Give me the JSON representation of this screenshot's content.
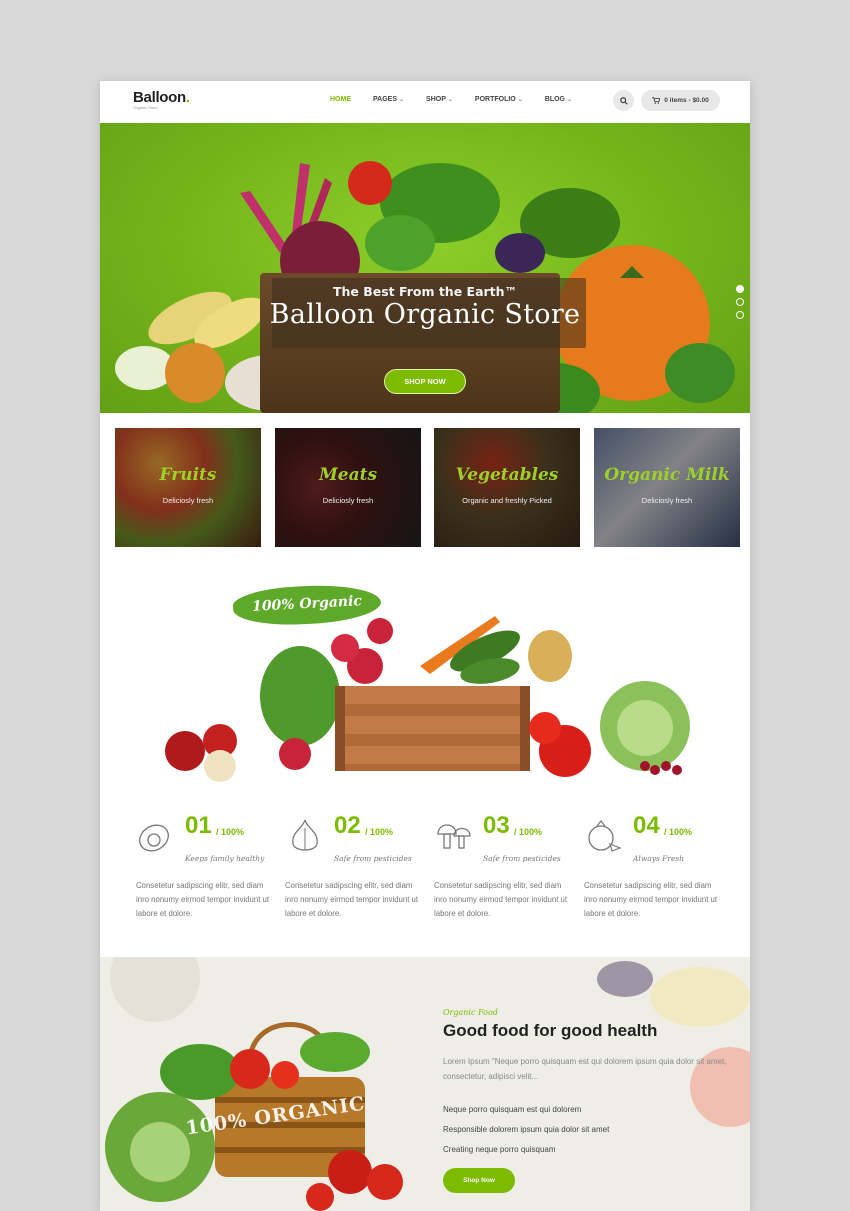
{
  "brand": {
    "name": "Balloon",
    "dot": ".",
    "subtitle": "Organic Store",
    "accent_color": "#7cbb00"
  },
  "nav": {
    "items": [
      {
        "label": "HOME",
        "active": true,
        "dropdown": false
      },
      {
        "label": "PAGES",
        "active": false,
        "dropdown": true
      },
      {
        "label": "SHOP",
        "active": false,
        "dropdown": true
      },
      {
        "label": "PORTFOLIO",
        "active": false,
        "dropdown": true
      },
      {
        "label": "BLOG",
        "active": false,
        "dropdown": true
      }
    ],
    "search_icon": "search-icon",
    "cart_icon": "cart-icon",
    "cart_label": "0 items - $0.00"
  },
  "hero": {
    "tagline": "The Best From the Earth™",
    "title": "Balloon Organic Store",
    "button": "SHOP NOW",
    "slides": 3,
    "active_slide": 1
  },
  "categories": [
    {
      "title": "Fruits",
      "subtitle": "Deliciosly fresh"
    },
    {
      "title": "Meats",
      "subtitle": "Deliciosly fresh"
    },
    {
      "title": "Vegetables",
      "subtitle": "Organic and freshly Picked"
    },
    {
      "title": "Organic Milk",
      "subtitle": "Deliciosly fresh"
    }
  ],
  "organic_badge": "100% Organic",
  "features": [
    {
      "num": "01",
      "pct": "/ 100%",
      "name": "Keeps family healthy",
      "icon": "avocado-icon",
      "text": "Consetetur sadipscing elitr, sed diam inro nonumy eirmod tempor invidunt ut labore et dolore."
    },
    {
      "num": "02",
      "pct": "/ 100%",
      "name": "Safe from pesticides",
      "icon": "garlic-icon",
      "text": "Consetetur sadipscing elitr, sed diam inro nonumy eirmod tempor invidunt ut labore et dolore."
    },
    {
      "num": "03",
      "pct": "/ 100%",
      "name": "Safe from pesticides",
      "icon": "mushroom-icon",
      "text": "Consetetur sadipscing elitr, sed diam inro nonumy eirmod tempor invidunt ut labore et dolore."
    },
    {
      "num": "04",
      "pct": "/ 100%",
      "name": "Always Fresh",
      "icon": "pomegranate-icon",
      "text": "Consetetur sadipscing elitr, sed diam inro nonumy eirmod tempor invidunt ut labore et dolore."
    }
  ],
  "good_food": {
    "eyebrow": "Organic Food",
    "title": "Good food for good health",
    "paragraph": "Lorem Ipsum \"Neque porro quisquam est qui dolorem ipsum quia dolor sit amet, consectetur, adipisci velit...",
    "bullets": [
      "Neque porro quisquam est qui dolorem",
      "Responsible dolorem ipsum quia dolor sit amet",
      "Creating neque porro quisquam"
    ],
    "button": "Shop Now",
    "basket_text": "100% ORGANIC"
  }
}
